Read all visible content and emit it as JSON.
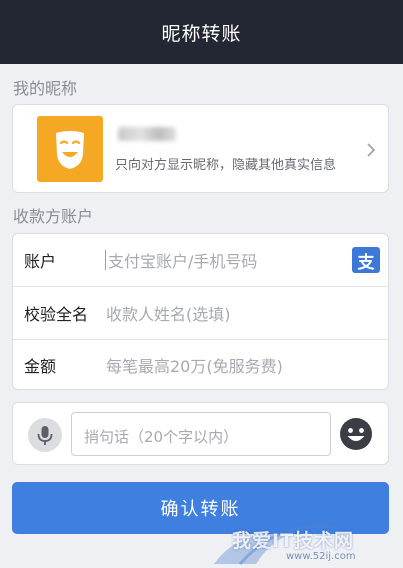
{
  "header": {
    "title": "昵称转账"
  },
  "nickname_section": {
    "label": "我的昵称",
    "description": "只向对方显示昵称，隐藏其他真实信息"
  },
  "payee_section": {
    "label": "收款方账户",
    "fields": [
      {
        "label": "账户",
        "placeholder": "支付宝账户/手机号码"
      },
      {
        "label": "校验全名",
        "placeholder": "收款人姓名(选填)"
      },
      {
        "label": "金额",
        "placeholder": "每笔最高20万(免服务费)"
      }
    ],
    "alipay_icon_glyph": "支"
  },
  "message": {
    "placeholder": "捎句话（20个字以内）"
  },
  "confirm_button": {
    "label": "确认转账"
  },
  "watermark": {
    "text": "我爱IT技术网",
    "url": "www.52ij.com"
  },
  "colors": {
    "header_bg": "#232733",
    "accent_blue": "#3f7fe0",
    "mask_tile": "#f5a824",
    "page_bg": "#eff0f4"
  },
  "icons": [
    "mask-icon",
    "chevron-right-icon",
    "alipay-contacts-icon",
    "microphone-icon",
    "emoji-icon"
  ]
}
